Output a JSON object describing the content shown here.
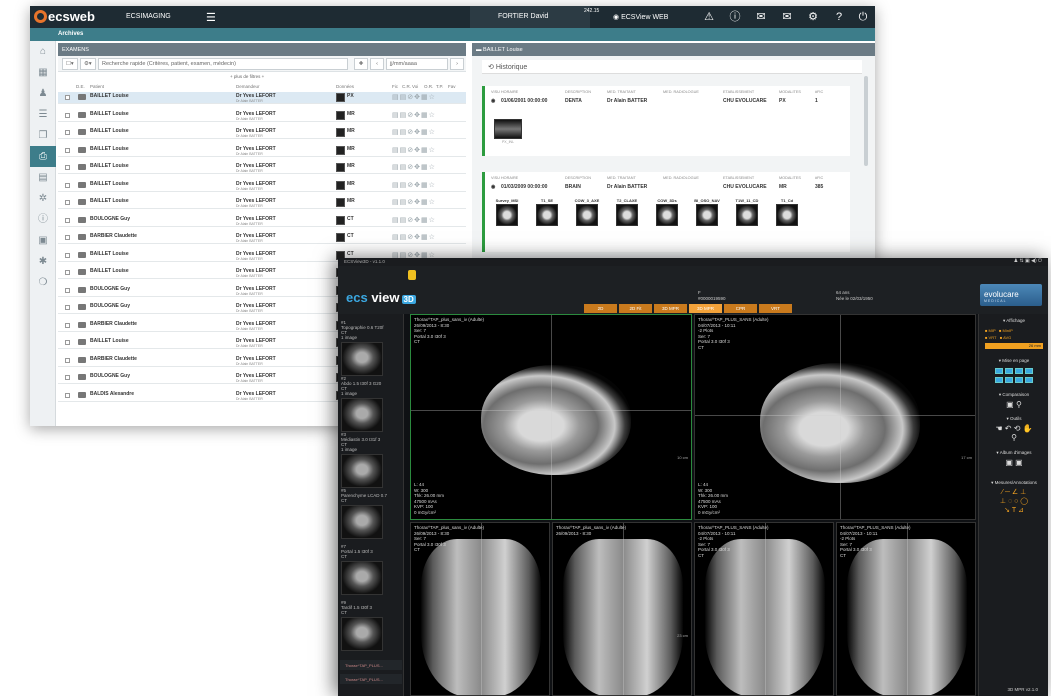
{
  "web": {
    "logo": "ecsweb",
    "app_name": "ECSIMAGING",
    "user": "FORTIER David",
    "clock": "242.15",
    "viewer_button": "ECSView WEB",
    "breadcrumb": "Archives",
    "left_icons": [
      "home-icon",
      "calendar-icon",
      "user-icon",
      "list-icon",
      "copy-icon",
      "print-icon",
      "chart-icon",
      "gear-icon",
      "info-icon",
      "image-icon",
      "settings-icon",
      "chat-icon"
    ],
    "exams_title": "EXAMENS",
    "search_placeholder": "Recherche rapide (Critères, patient, examen, médecin)",
    "date_placeholder": "jj/mm/aaaa",
    "more_filters": "+ plus de filtres +",
    "columns": [
      "D.E.",
      "Patient",
      "Demandeur",
      "Données",
      "Fic",
      "C.R.",
      "Voi",
      "O.R.",
      "T.P.",
      "Fav"
    ],
    "rows": [
      {
        "patient": "BAILLET Louise",
        "demandeur": "Dr Yves LEFORT",
        "mod": "PX",
        "sel": true
      },
      {
        "patient": "BAILLET Louise",
        "demandeur": "Dr Yves LEFORT",
        "mod": "MR",
        "sel": false
      },
      {
        "patient": "BAILLET Louise",
        "demandeur": "Dr Yves LEFORT",
        "mod": "MR",
        "sel": false
      },
      {
        "patient": "BAILLET Louise",
        "demandeur": "Dr Yves LEFORT",
        "mod": "MR",
        "sel": false
      },
      {
        "patient": "BAILLET Louise",
        "demandeur": "Dr Yves LEFORT",
        "mod": "MR",
        "sel": false
      },
      {
        "patient": "BAILLET Louise",
        "demandeur": "Dr Yves LEFORT",
        "mod": "MR",
        "sel": false
      },
      {
        "patient": "BAILLET Louise",
        "demandeur": "Dr Yves LEFORT",
        "mod": "MR",
        "sel": false
      },
      {
        "patient": "BOULOGNE Guy",
        "demandeur": "Dr Yves LEFORT",
        "mod": "CT",
        "sel": false
      },
      {
        "patient": "BARBIER Claudette",
        "demandeur": "Dr Yves LEFORT",
        "mod": "CT",
        "sel": false
      },
      {
        "patient": "BAILLET Louise",
        "demandeur": "Dr Yves LEFORT",
        "mod": "CT",
        "sel": false
      },
      {
        "patient": "BAILLET Louise",
        "demandeur": "Dr Yves LEFORT",
        "mod": "CR",
        "sel": false
      },
      {
        "patient": "BOULOGNE Guy",
        "demandeur": "Dr Yves LEFORT",
        "mod": "CT",
        "sel": false
      },
      {
        "patient": "BOULOGNE Guy",
        "demandeur": "Dr Yves LEFORT",
        "mod": "CT",
        "sel": false
      },
      {
        "patient": "BARBIER Claudette",
        "demandeur": "Dr Yves LEFORT",
        "mod": "CT",
        "sel": false
      },
      {
        "patient": "BAILLET Louise",
        "demandeur": "Dr Yves LEFORT",
        "mod": "CR",
        "sel": false
      },
      {
        "patient": "BARBIER Claudette",
        "demandeur": "Dr Yves LEFORT",
        "mod": "CT",
        "sel": false
      },
      {
        "patient": "BOULOGNE Guy",
        "demandeur": "Dr Yves LEFORT",
        "mod": "CT",
        "sel": false
      },
      {
        "patient": "BALDIS Alexandre",
        "demandeur": "Dr Yves LEFORT",
        "mod": "US",
        "sel": false
      }
    ],
    "row_sub_requester": "Dr Alain BATTER",
    "history_patient": "BAILLET Louise",
    "history_title": "Historique",
    "history_headers": [
      "VISU HORAIRE",
      "DESCRIPTION",
      "MED. TRAITANT",
      "MED. RADIOLOGUE",
      "ETABLISSEMENT",
      "MODALITES",
      "#FIC"
    ],
    "history_card1": {
      "date": "01/06/2001 00:00:00",
      "desc": "DENTA",
      "med": "Dr Alain BATTER",
      "etab": "CHU EVOLUCARE",
      "mod": "PX",
      "fic": "1"
    },
    "history_card1_thumb": "PX_INL",
    "history_card2": {
      "date": "01/03/2009 00:00:00",
      "desc": "BRAIN",
      "med": "Dr Alain BATTER",
      "etab": "CHU EVOLUCARE",
      "mod": "MR",
      "fic": "385"
    },
    "history_series": [
      "Survey_MSI",
      "T1_SE",
      "COW_3_AXE",
      "T2_CLAXE",
      "COW_3Ds",
      "BI_OSO_NAV",
      "T1W_11_CD",
      "T1_Cd"
    ]
  },
  "viewer": {
    "title": "ECSView3D - v1.1.0",
    "logo_main": "ecs",
    "logo_sub": "view",
    "logo_tag": "3D",
    "modes": [
      "2D",
      "2D Fit",
      "3D MPR",
      "3D MPR",
      "CPR",
      "VRT"
    ],
    "active_mode": 3,
    "patient_sex": "F",
    "patient_id": "#0000019590",
    "patient_age": "64 ans",
    "patient_birth": "Née le 02/03/1950",
    "brand": "evolucare",
    "brand_sub": "MEDICAL",
    "series_thumbs": [
      {
        "num": "#1",
        "name": "Topographie 0.6 T20f",
        "sub": "CT",
        "count": "1 image"
      },
      {
        "num": "#2",
        "name": "Abdo 1.5 I30f 3 G20",
        "sub": "CT",
        "count": "1 image"
      },
      {
        "num": "#3",
        "name": "Médiastin 3.0 I31f 3",
        "sub": "CT",
        "count": "1 image"
      },
      {
        "num": "#5",
        "name": "Parenchyme LCAD 0.7",
        "sub": "CT",
        "count": ""
      },
      {
        "num": "#7",
        "name": "Portal 1.5 I30f 3",
        "sub": "CT",
        "count": ""
      },
      {
        "num": "#9",
        "name": "Tardif 1.5 I30f 3",
        "sub": "CT",
        "count": ""
      }
    ],
    "thumb_footers": [
      "Thorax^TAP_PLUS...",
      "Thorax^TAP_PLUS..."
    ],
    "vp1_caption": "Thorax^TAP_plus_sans_iv (Adulte)\n26/09/2013 - 8:30\nSer: 7\nPortal 3.0 I30f 3\nCT",
    "vp2_caption": "Thorax^TAP_PLUS_SANS (Adulte)\n04/07/2013 - 10:11\n-2 Plots\nSer: 7\nPortal 3.0 I30f 3\nCT",
    "vp1_info": "L: 44\nW: 300\nThk: 26.00 mm\n47500 mAs\nKVP: 100\n0 mGy/cm²",
    "vp2_info": "L: 44\nW: 300\nThk: 26.00 mm\n47500 mAs\nKVP: 100\n0 mGy/cm²",
    "vp3_caption": "Thorax^TAP_plus_sans_iv (Adulte)\n26/09/2013 - 8:30\nSer: 7\nPortal 3.0 I30f 3\nCT",
    "vp4_caption": "Thorax^TAP_plus_sans_iv (Adulte)\n26/09/2013 - 8:30",
    "vp5_caption": "Thorax^TAP_PLUS_SANS (Adulte)\n04/07/2013 - 10:11\n-2 Plots\nSer: 7\nPortal 3.0 I30f 3\nCT",
    "vp6_caption": "Thorax^TAP_PLUS_SANS (Adulte)\n04/07/2013 - 10:11\n-2 Plots\nSer: 7\nPortal 3.0 I30f 3\nCT",
    "scale_label": "10 cm",
    "scale_label2": "17 cm",
    "scale_label3": "23 cm",
    "panel": {
      "affichage": "Affichage",
      "aff_opts": [
        "MIP",
        "MinIP",
        "VRT",
        "AVG"
      ],
      "thickness": "26 mm",
      "mise_en_page": "Mise en page",
      "comparaison": "Comparaison",
      "outils": "Outils",
      "album": "Album d'images",
      "mesures": "Mesures/Annotations"
    },
    "footer": "3D MPR v2.1.0"
  }
}
